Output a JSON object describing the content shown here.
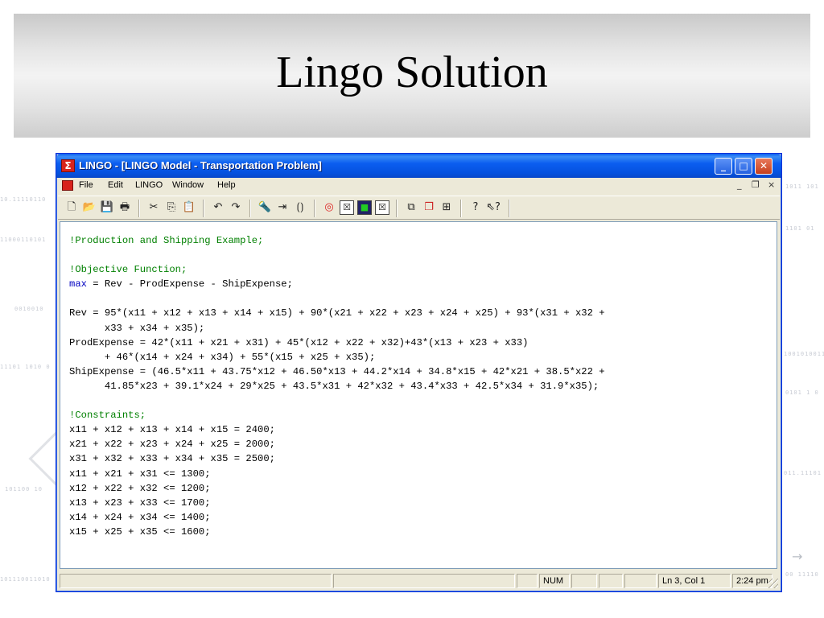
{
  "slide": {
    "title": "Lingo Solution"
  },
  "window": {
    "title": "LINGO - [LINGO Model - Transportation Problem]",
    "buttons": {
      "minimize": "_",
      "maximize": "□",
      "close": "✕"
    },
    "accent_color": "#0a5ff0"
  },
  "menubar": {
    "items": [
      "File",
      "Edit",
      "LINGO",
      "Window",
      "Help"
    ],
    "mdi": {
      "minimize": "_",
      "restore": "❐",
      "close": "×"
    }
  },
  "toolbar": {
    "icons": [
      "new-icon",
      "open-icon",
      "save-icon",
      "print-icon",
      "cut-icon",
      "copy-icon",
      "paste-icon",
      "undo-icon",
      "redo-icon",
      "find-icon",
      "goto-line-icon",
      "match-paren-icon",
      "solve-icon",
      "solution-icon",
      "matrix-picture-icon",
      "close-all-icon",
      "tile-icon",
      "cascade-icon",
      "arrange-icon",
      "help-icon",
      "context-help-icon"
    ]
  },
  "code": {
    "lines": [
      {
        "text": "!Production and Shipping Example;",
        "kind": "comment"
      },
      {
        "text": "",
        "kind": "plain"
      },
      {
        "text": "!Objective Function;",
        "kind": "comment"
      },
      {
        "keyword": "max",
        "text": " = Rev - ProdExpense - ShipExpense;",
        "kind": "keyword"
      },
      {
        "text": "",
        "kind": "plain"
      },
      {
        "text": "Rev = 95*(x11 + x12 + x13 + x14 + x15) + 90*(x21 + x22 + x23 + x24 + x25) + 93*(x31 + x32 +",
        "kind": "plain"
      },
      {
        "text": "      x33 + x34 + x35);",
        "kind": "plain"
      },
      {
        "text": "ProdExpense = 42*(x11 + x21 + x31) + 45*(x12 + x22 + x32)+43*(x13 + x23 + x33)",
        "kind": "plain"
      },
      {
        "text": "      + 46*(x14 + x24 + x34) + 55*(x15 + x25 + x35);",
        "kind": "plain"
      },
      {
        "text": "ShipExpense = (46.5*x11 + 43.75*x12 + 46.50*x13 + 44.2*x14 + 34.8*x15 + 42*x21 + 38.5*x22 +",
        "kind": "plain"
      },
      {
        "text": "      41.85*x23 + 39.1*x24 + 29*x25 + 43.5*x31 + 42*x32 + 43.4*x33 + 42.5*x34 + 31.9*x35);",
        "kind": "plain"
      },
      {
        "text": "",
        "kind": "plain"
      },
      {
        "text": "!Constraints;",
        "kind": "comment"
      },
      {
        "text": "x11 + x12 + x13 + x14 + x15 = 2400;",
        "kind": "plain"
      },
      {
        "text": "x21 + x22 + x23 + x24 + x25 = 2000;",
        "kind": "plain"
      },
      {
        "text": "x31 + x32 + x33 + x34 + x35 = 2500;",
        "kind": "plain"
      },
      {
        "text": "x11 + x21 + x31 <= 1300;",
        "kind": "plain"
      },
      {
        "text": "x12 + x22 + x32 <= 1200;",
        "kind": "plain"
      },
      {
        "text": "x13 + x23 + x33 <= 1700;",
        "kind": "plain"
      },
      {
        "text": "x14 + x24 + x34 <= 1400;",
        "kind": "plain"
      },
      {
        "text": "x15 + x25 + x35 <= 1600;",
        "kind": "plain"
      }
    ],
    "comment_color": "#008000",
    "keyword_color": "#0000c0"
  },
  "statusbar": {
    "num": "NUM",
    "position": "Ln 3, Col 1",
    "time": "2:24 pm"
  }
}
